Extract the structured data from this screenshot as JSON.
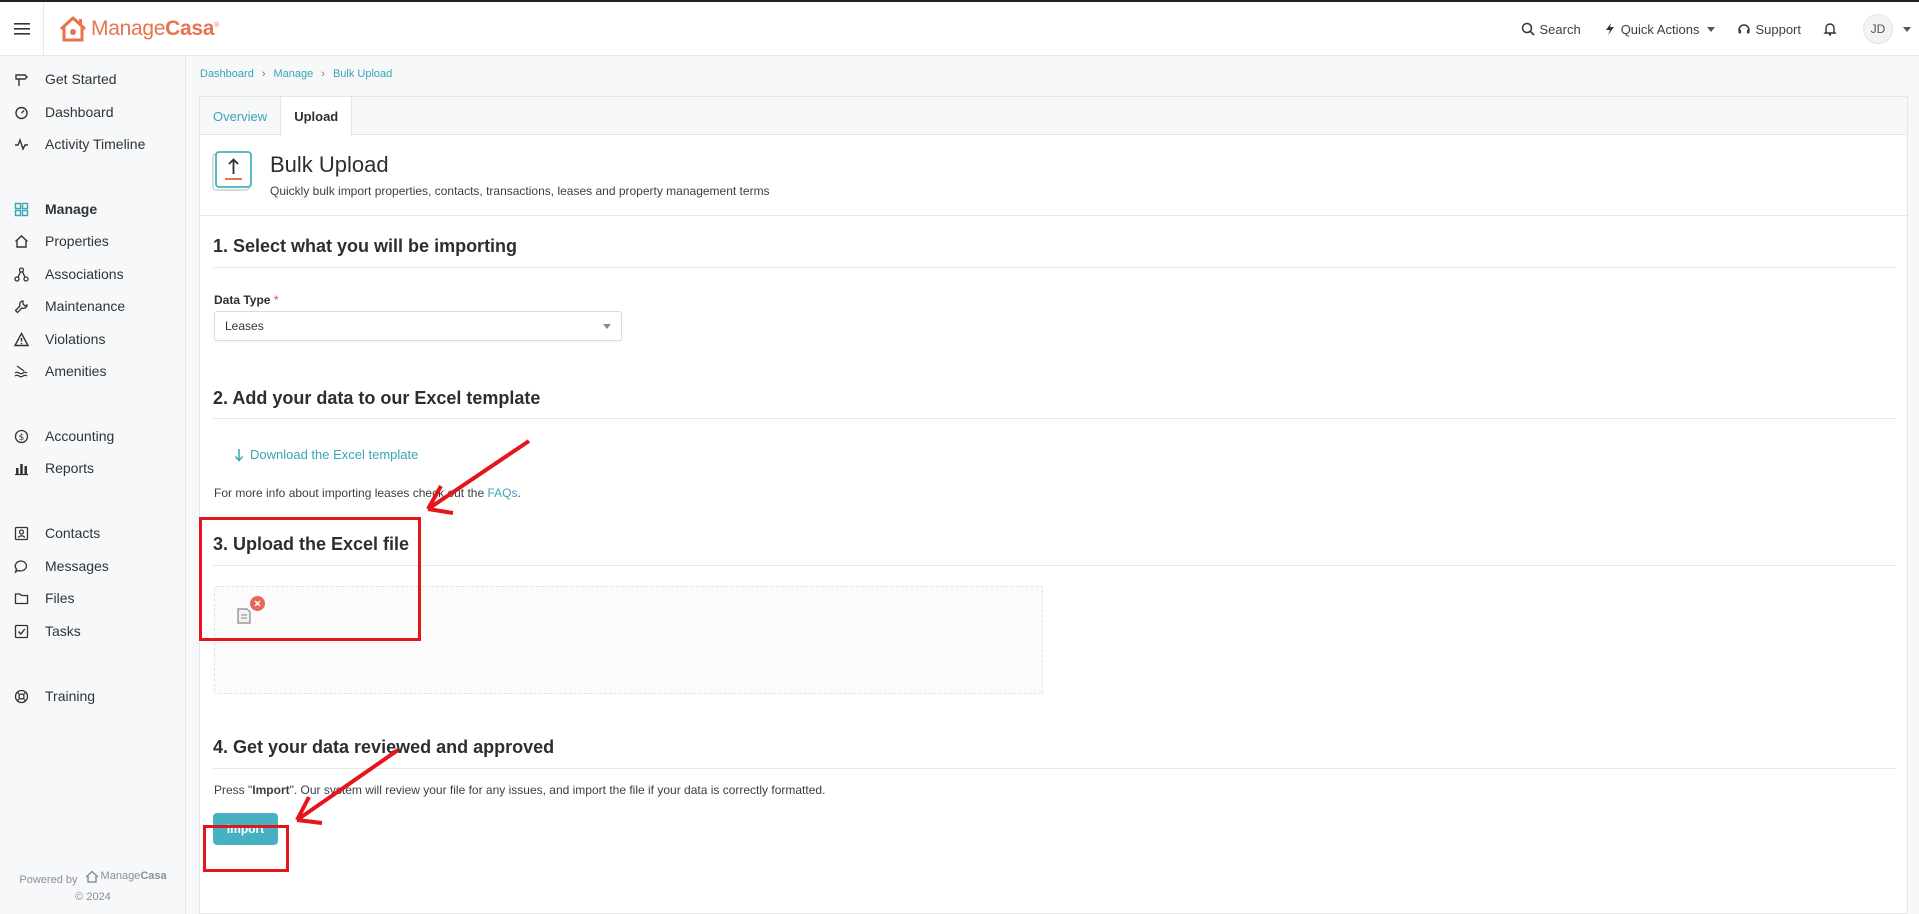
{
  "header": {
    "logo_prefix": "Manage",
    "logo_suffix": "Casa",
    "search_label": "Search",
    "quick_actions_label": "Quick Actions",
    "support_label": "Support",
    "avatar_initials": "JD"
  },
  "sidebar": {
    "items": [
      {
        "label": "Get Started",
        "icon": "signpost-icon"
      },
      {
        "label": "Dashboard",
        "icon": "gauge-icon"
      },
      {
        "label": "Activity Timeline",
        "icon": "pulse-icon"
      },
      {
        "label": "Manage",
        "icon": "grid-icon"
      },
      {
        "label": "Properties",
        "icon": "house-icon"
      },
      {
        "label": "Associations",
        "icon": "network-icon"
      },
      {
        "label": "Maintenance",
        "icon": "wrench-icon"
      },
      {
        "label": "Violations",
        "icon": "warning-icon"
      },
      {
        "label": "Amenities",
        "icon": "pool-icon"
      },
      {
        "label": "Accounting",
        "icon": "dollar-icon"
      },
      {
        "label": "Reports",
        "icon": "bar-chart-icon"
      },
      {
        "label": "Contacts",
        "icon": "contact-card-icon"
      },
      {
        "label": "Messages",
        "icon": "chat-bubble-icon"
      },
      {
        "label": "Files",
        "icon": "folder-icon"
      },
      {
        "label": "Tasks",
        "icon": "checkbox-icon"
      },
      {
        "label": "Training",
        "icon": "lifebuoy-icon"
      }
    ],
    "powered_by": "Powered by",
    "powered_logo_prefix": "Manage",
    "powered_logo_suffix": "Casa",
    "copyright": "© 2024"
  },
  "breadcrumb": [
    "Dashboard",
    "Manage",
    "Bulk Upload"
  ],
  "tabs": [
    {
      "label": "Overview"
    },
    {
      "label": "Upload"
    }
  ],
  "page": {
    "title": "Bulk Upload",
    "subtitle": "Quickly bulk import properties, contacts, transactions, leases and property management terms"
  },
  "sections": {
    "s1_title": "1. Select what you will be importing",
    "data_type_label": "Data Type",
    "required_mark": "*",
    "data_type_value": "Leases",
    "s2_title": "2. Add your data to our Excel template",
    "download_link": "Download the Excel template",
    "info_prefix": "For more info about importing leases check out the ",
    "info_link": "FAQs",
    "info_suffix": ".",
    "s3_title": "3. Upload the Excel file",
    "s4_title": "4. Get your data reviewed and approved",
    "press_prefix": "Press \"",
    "press_bold": "Import",
    "press_suffix": "\". Our system will review your file for any issues, and import the file if your data is correctly formatted.",
    "import_button": "Import"
  },
  "colors": {
    "brand": "#e8734f",
    "accent": "#3aa4b4",
    "button": "#46b2c1",
    "annotation": "#e4161c"
  }
}
